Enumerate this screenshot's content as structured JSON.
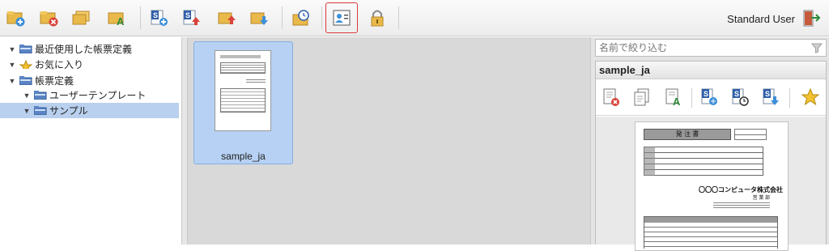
{
  "toolbar": {
    "buttons": [
      {
        "name": "new-form-button",
        "icon": "folder-add-icon"
      },
      {
        "name": "delete-form-button",
        "icon": "folder-delete-icon"
      },
      {
        "name": "copy-form-button",
        "icon": "folder-copy-icon"
      },
      {
        "name": "rename-form-button",
        "icon": "folder-rename-icon"
      },
      {
        "name": "add-source-button",
        "icon": "source-add-icon"
      },
      {
        "name": "upload-source-button",
        "icon": "source-upload-icon"
      },
      {
        "name": "import-button",
        "icon": "folder-import-icon"
      },
      {
        "name": "export-button",
        "icon": "folder-export-icon"
      },
      {
        "name": "history-button",
        "icon": "history-icon"
      },
      {
        "name": "user-info-button",
        "icon": "user-card-icon"
      },
      {
        "name": "lock-button",
        "icon": "lock-icon"
      }
    ],
    "user_label": "Standard User",
    "logout_icon": "logout-icon"
  },
  "tree": {
    "items": [
      {
        "label": "最近使用した帳票定義",
        "icon": "folder-icon",
        "level": 0
      },
      {
        "label": "お気に入り",
        "icon": "star-icon",
        "level": 0
      },
      {
        "label": "帳票定義",
        "icon": "folder-icon",
        "level": 0
      },
      {
        "label": "ユーザーテンプレート",
        "icon": "folder-icon",
        "level": 1
      },
      {
        "label": "サンプル",
        "icon": "folder-icon",
        "level": 1,
        "selected": true
      }
    ]
  },
  "center": {
    "card_label": "sample_ja"
  },
  "right": {
    "filter_placeholder": "名前で絞り込む",
    "panel_title": "sample_ja",
    "preview_title": "発 注 書",
    "preview_company": "〇〇〇コンピュータ株式会社",
    "preview_dept": "営 業 部"
  },
  "colors": {
    "selection": "#b9d0ee",
    "card": "#b6d1f3",
    "highlight_border": "#d93a3a"
  }
}
